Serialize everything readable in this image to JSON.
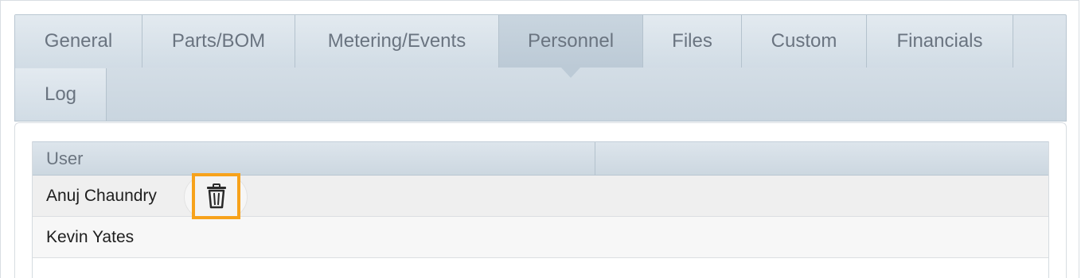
{
  "tabs": [
    {
      "label": "General"
    },
    {
      "label": "Parts/BOM"
    },
    {
      "label": "Metering/Events"
    },
    {
      "label": "Personnel",
      "active": true
    },
    {
      "label": "Files"
    },
    {
      "label": "Custom"
    },
    {
      "label": "Financials"
    },
    {
      "label": "Log"
    }
  ],
  "grid": {
    "columns": [
      "User",
      ""
    ],
    "rows": [
      {
        "user": "Anuj Chaundry"
      },
      {
        "user": "Kevin Yates"
      }
    ]
  },
  "icons": {
    "delete": "trash-icon"
  },
  "colors": {
    "highlight": "#f7a21b",
    "tab_text": "#6a7480"
  }
}
